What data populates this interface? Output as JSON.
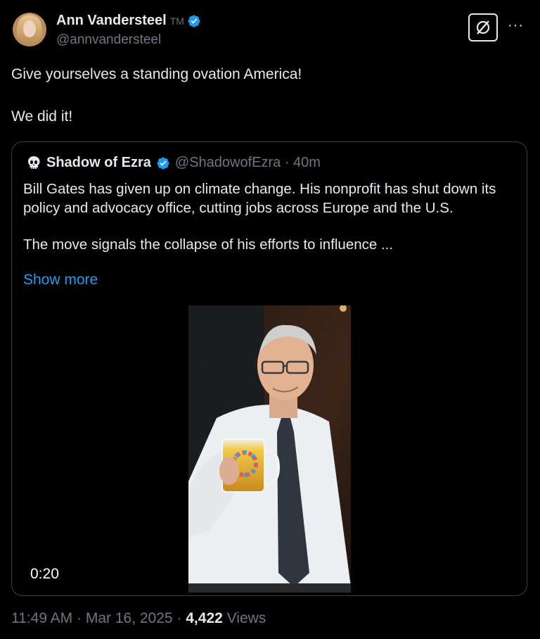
{
  "author": {
    "name": "Ann Vandersteel",
    "tm": "TM",
    "handle": "@annvandersteel"
  },
  "icons": [
    "verified-badge-icon",
    "grok-icon",
    "more-options-icon",
    "punisher-skull-icon"
  ],
  "colors": {
    "accent": "#1d9bf0",
    "verified": "#1d9bf0",
    "muted": "#71767b",
    "text": "#e7e9ea",
    "background": "#000000"
  },
  "tweet": {
    "line1": "Give yourselves a standing ovation America!",
    "line2": "We did it!"
  },
  "quote": {
    "name": "Shadow of Ezra",
    "handle": "@ShadowofEzra · 40m",
    "paragraph1": "Bill Gates has given up on climate change. His nonprofit has shut down its policy and advocacy office, cutting jobs across Europe and the U.S.",
    "paragraph2": "The move signals the collapse of his efforts to influence ...",
    "show_more": "Show more",
    "video_duration": "0:20"
  },
  "meta": {
    "time": "11:49 AM · Mar 16, 2025 · ",
    "views_count": "4,422",
    "views_label": " Views"
  }
}
